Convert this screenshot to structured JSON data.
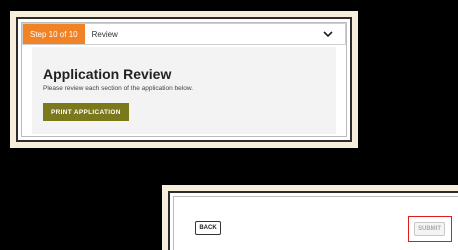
{
  "step": {
    "badge": "Step 10 of 10",
    "title": "Review",
    "accent_color": "#f08326"
  },
  "section": {
    "title": "Application Review",
    "subtitle": "Please review each section of the application below.",
    "print_button": "PRINT APPLICATION",
    "print_button_color": "#7a7a1c"
  },
  "footer": {
    "back_button": "BACK",
    "submit_button": "SUBMIT",
    "highlight_color": "#e01b1b"
  },
  "icons": {
    "expand": "chevron-down-icon"
  }
}
